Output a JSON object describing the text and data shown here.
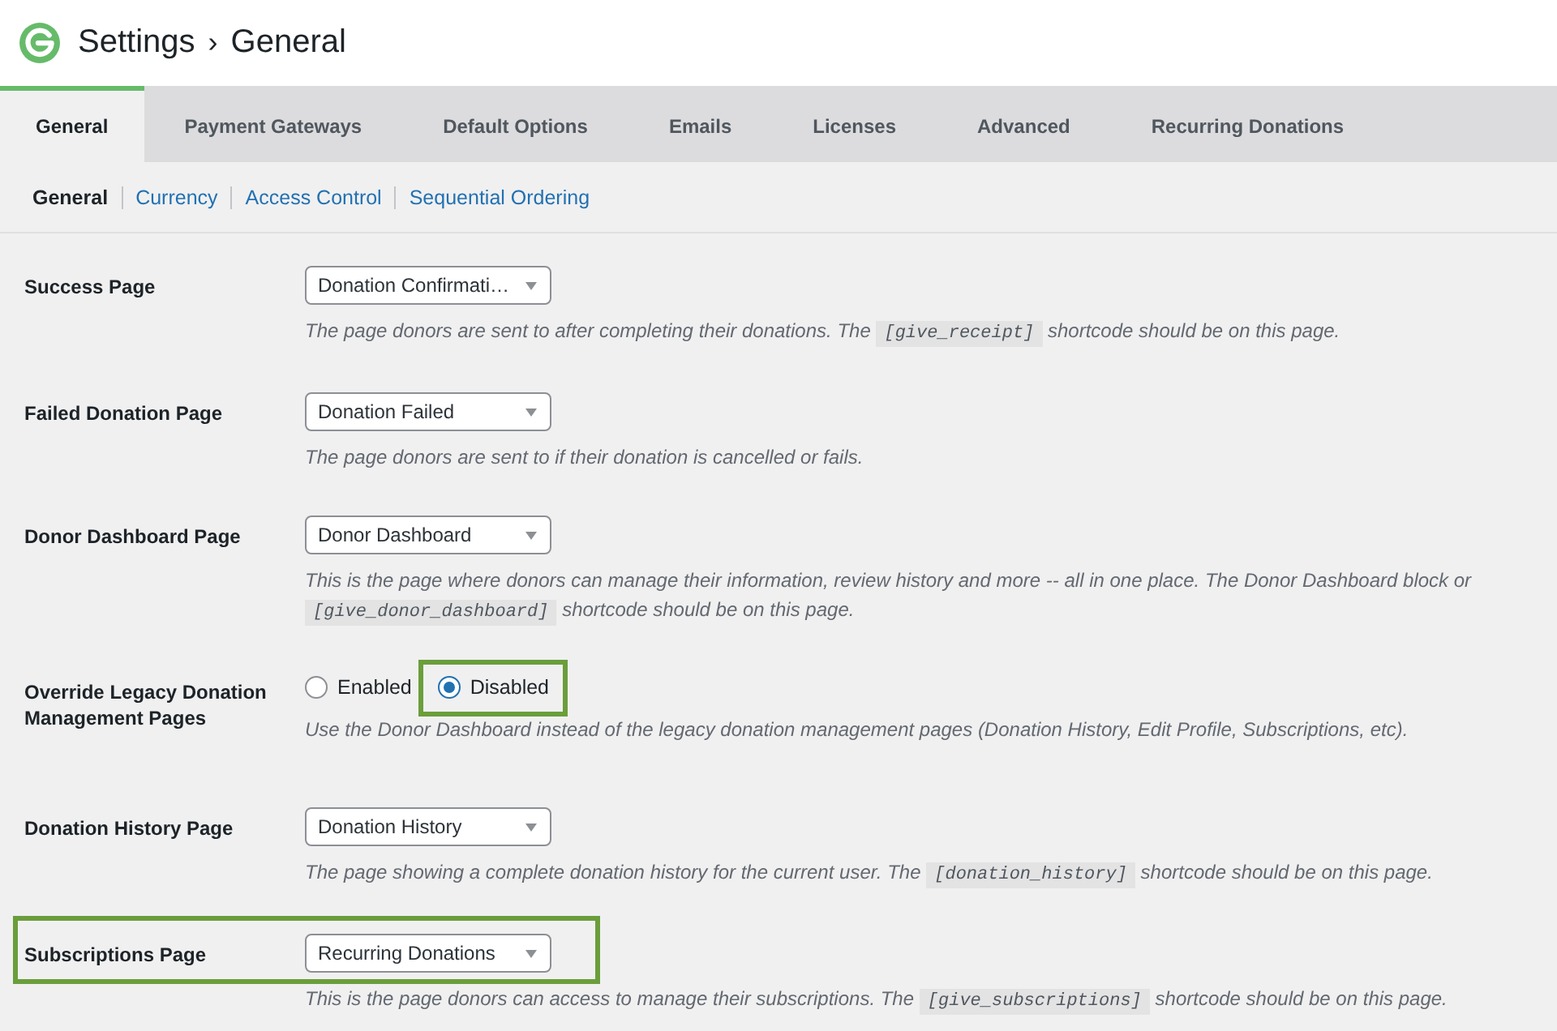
{
  "header": {
    "breadcrumb": [
      "Settings",
      "General"
    ],
    "separator": "›"
  },
  "tabs": [
    {
      "label": "General",
      "selected": true
    },
    {
      "label": "Payment Gateways",
      "selected": false
    },
    {
      "label": "Default Options",
      "selected": false
    },
    {
      "label": "Emails",
      "selected": false
    },
    {
      "label": "Licenses",
      "selected": false
    },
    {
      "label": "Advanced",
      "selected": false
    },
    {
      "label": "Recurring Donations",
      "selected": false
    }
  ],
  "subtabs": [
    {
      "label": "General",
      "selected": true
    },
    {
      "label": "Currency",
      "selected": false
    },
    {
      "label": "Access Control",
      "selected": false
    },
    {
      "label": "Sequential Ordering",
      "selected": false
    }
  ],
  "settings": [
    {
      "kind": "select",
      "label": "Success Page",
      "value": "Donation Confirmati…",
      "highlighted": false,
      "description": [
        {
          "kind": "text",
          "text": "The page donors are sent to after completing their donations. The"
        },
        {
          "kind": "code",
          "text": "[give_receipt]"
        },
        {
          "kind": "text",
          "text": "shortcode should be on this page."
        }
      ]
    },
    {
      "kind": "select",
      "label": "Failed Donation Page",
      "value": "Donation Failed",
      "highlighted": false,
      "description": [
        {
          "kind": "text",
          "text": "The page donors are sent to if their donation is cancelled or fails."
        }
      ]
    },
    {
      "kind": "select",
      "label": "Donor Dashboard Page",
      "value": "Donor Dashboard",
      "highlighted": false,
      "description": [
        {
          "kind": "text",
          "text": "This is the page where donors can manage their information, review history and more -- all in one place. The Donor Dashboard block or"
        },
        {
          "kind": "code",
          "text": "[give_donor_dashboard]"
        },
        {
          "kind": "text",
          "text": "shortcode should be on this page."
        }
      ]
    },
    {
      "kind": "radio",
      "label": "Override Legacy Donation Management Pages",
      "highlighted": false,
      "options": [
        {
          "label": "Enabled",
          "selected": false,
          "highlighted": false
        },
        {
          "label": "Disabled",
          "selected": true,
          "highlighted": true
        }
      ],
      "description": [
        {
          "kind": "text",
          "text": "Use the Donor Dashboard instead of the legacy donation management pages (Donation History, Edit Profile, Subscriptions, etc)."
        }
      ]
    },
    {
      "kind": "select",
      "label": "Donation History Page",
      "value": "Donation History",
      "highlighted": false,
      "description": [
        {
          "kind": "text",
          "text": "The page showing a complete donation history for the current user. The"
        },
        {
          "kind": "code",
          "text": "[donation_history]"
        },
        {
          "kind": "text",
          "text": "shortcode should be on this page."
        }
      ]
    },
    {
      "kind": "select",
      "label": "Subscriptions Page",
      "value": "Recurring Donations",
      "highlighted": true,
      "description": [
        {
          "kind": "text",
          "text": "This is the page donors can access to manage their subscriptions. The"
        },
        {
          "kind": "code",
          "text": "[give_subscriptions]"
        },
        {
          "kind": "text",
          "text": "shortcode should be on this page."
        }
      ]
    }
  ]
}
